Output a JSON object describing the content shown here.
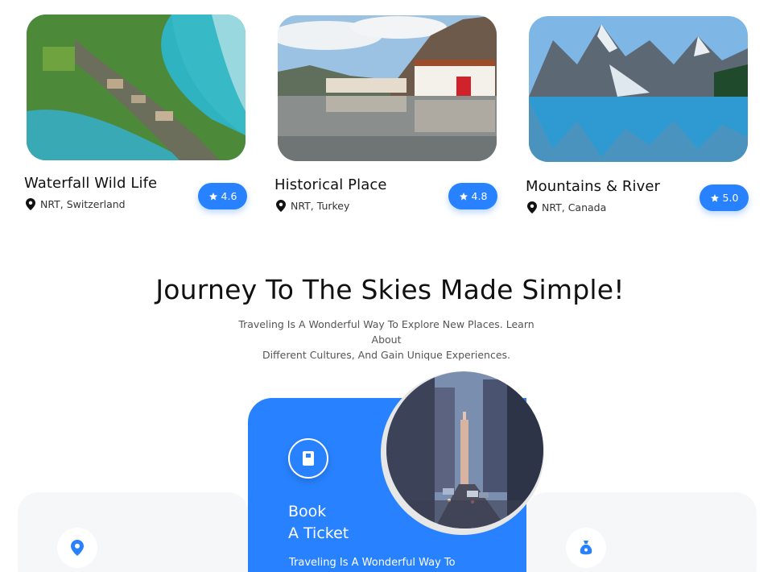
{
  "destinations": [
    {
      "name": "Waterfall Wild Life",
      "location": "NRT, Switzerland",
      "rating": "4.6"
    },
    {
      "name": "Historical Place",
      "location": "NRT, Turkey",
      "rating": "4.8"
    },
    {
      "name": "Mountains & River",
      "location": "NRT, Canada",
      "rating": "5.0"
    }
  ],
  "section": {
    "title": "Journey To The Skies Made Simple!",
    "subtitle_line1": "Traveling Is A Wonderful Way To Explore New Places. Learn About",
    "subtitle_line2": "Different Cultures, And Gain Unique Experiences."
  },
  "feature": {
    "title_line1": "Book",
    "title_line2": "A Ticket",
    "text": "Traveling Is A Wonderful Way To"
  },
  "colors": {
    "accent": "#2882ff",
    "card_bg": "#f6f7f9",
    "text_dark": "#111111",
    "text_muted": "#555555"
  },
  "icons": [
    "location-pin-icon",
    "star-icon",
    "book-icon",
    "map-marker-icon",
    "money-bag-icon"
  ]
}
